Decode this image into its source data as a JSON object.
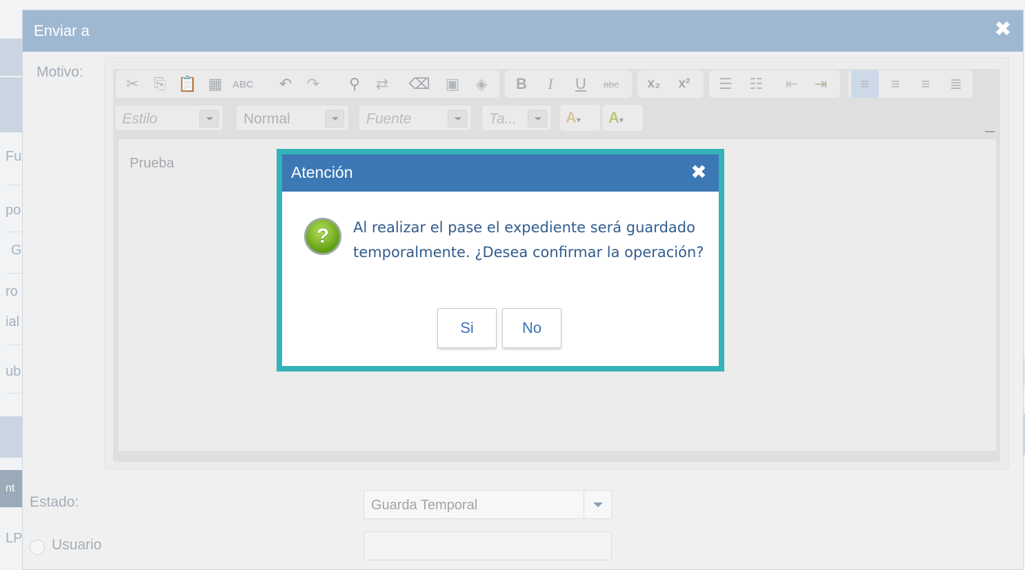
{
  "background": {
    "fragments": [
      "Fu",
      "po",
      "G",
      "ro",
      "ial",
      "ub",
      "nt",
      "LP"
    ]
  },
  "window": {
    "title": "Enviar a",
    "close_glyph": "✖"
  },
  "form": {
    "motivo_label": "Motivo:",
    "estado_label": "Estado:",
    "estado_value": "Guarda Temporal",
    "usuario_label": "Usuario"
  },
  "editor": {
    "combos": {
      "style": "Estilo",
      "format": "Normal",
      "font": "Fuente",
      "size": "Ta..."
    },
    "content": "Prueba"
  },
  "dialog": {
    "title": "Atención",
    "close_glyph": "✖",
    "icon_glyph": "?",
    "message": "Al realizar el pase el expediente será guardado temporalmente. ¿Desea confirmar la operación?",
    "yes_label": "Si",
    "no_label": "No",
    "highlight_color": "#35b3b8",
    "header_color": "#3c78b5"
  }
}
